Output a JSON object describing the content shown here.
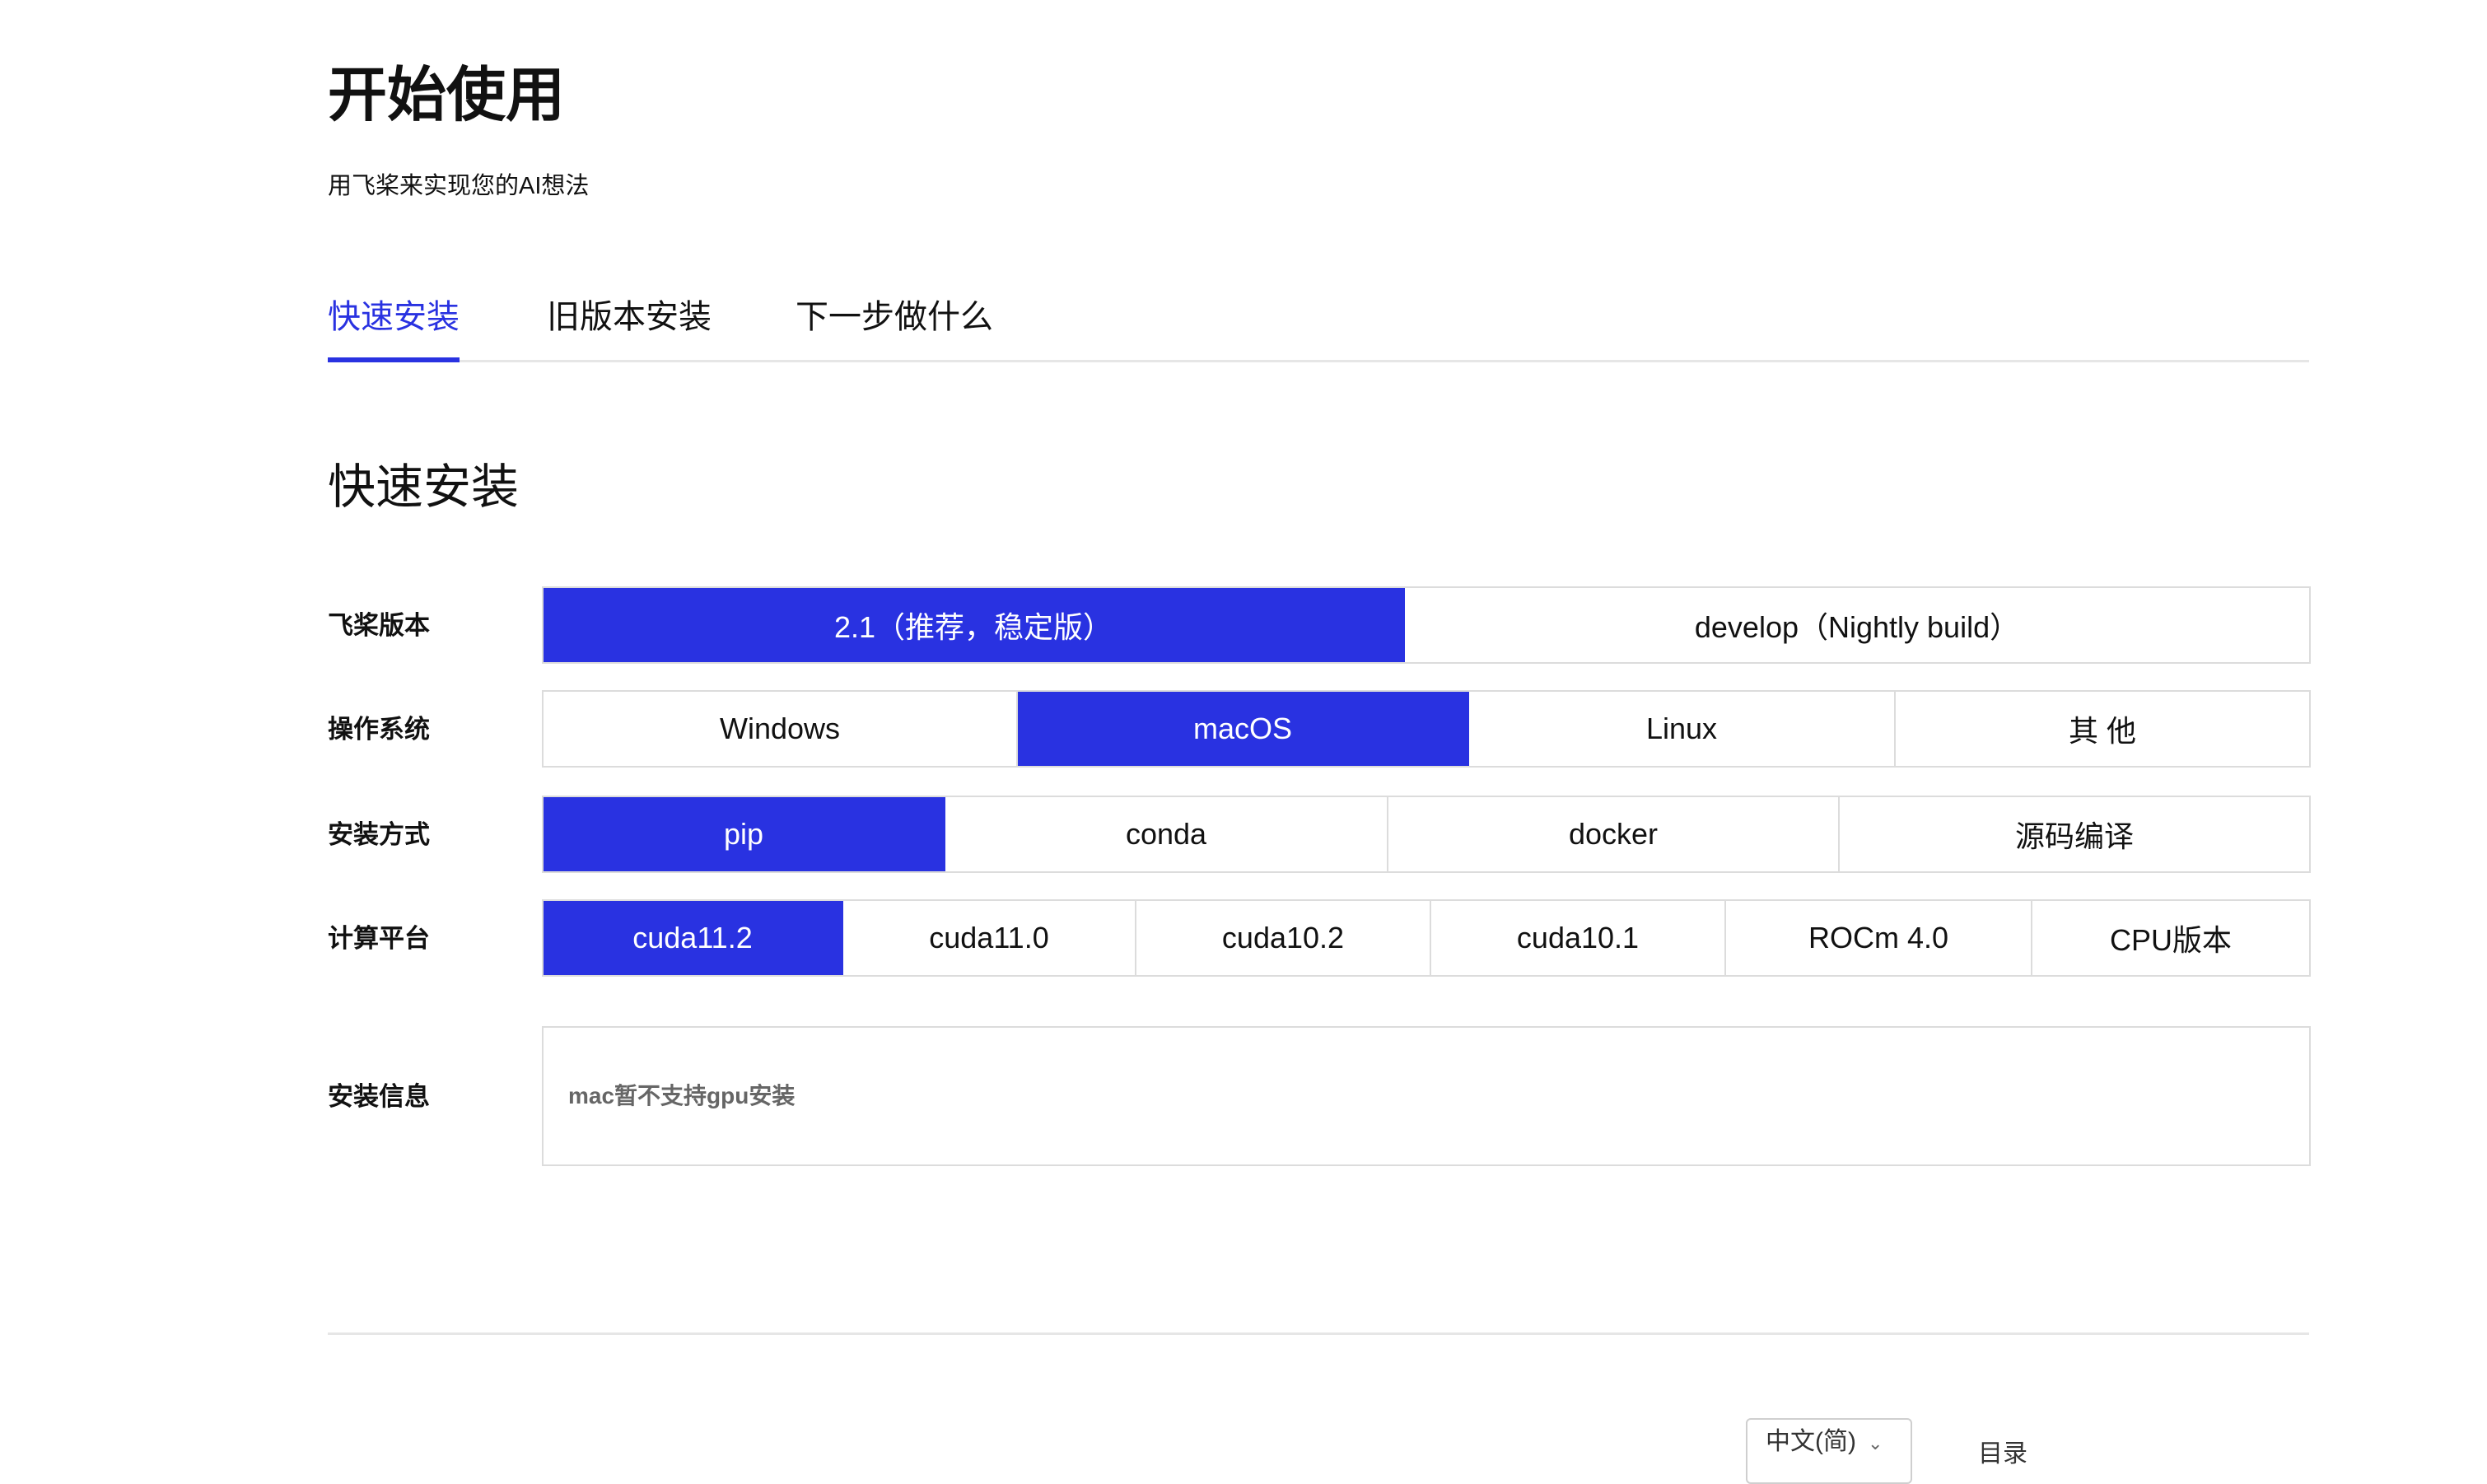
{
  "header": {
    "title": "开始使用",
    "subtitle": "用飞桨来实现您的AI想法"
  },
  "tabs": [
    {
      "label": "快速安装",
      "active": true
    },
    {
      "label": "旧版本安装",
      "active": false
    },
    {
      "label": "下一步做什么",
      "active": false
    }
  ],
  "section": {
    "title": "快速安装"
  },
  "selector": {
    "version": {
      "label": "飞桨版本",
      "options": [
        "2.1（推荐，稳定版）",
        "develop（Nightly build）"
      ],
      "selected": 0
    },
    "os": {
      "label": "操作系统",
      "options": [
        "Windows",
        "macOS",
        "Linux",
        "其 他"
      ],
      "selected": 1
    },
    "install_method": {
      "label": "安装方式",
      "options": [
        "pip",
        "conda",
        "docker",
        "源码编译"
      ],
      "selected": 0
    },
    "compute_platform": {
      "label": "计算平台",
      "options": [
        "cuda11.2",
        "cuda11.0",
        "cuda10.2",
        "cuda10.1",
        "ROCm 4.0",
        "CPU版本"
      ],
      "selected": 0
    }
  },
  "install_info": {
    "label": "安装信息",
    "text": "mac暂不支持gpu安装"
  },
  "footer": {
    "language": "中文(简)",
    "link": "目录"
  },
  "colors": {
    "accent": "#2932e1",
    "border": "#dcdcdc"
  }
}
